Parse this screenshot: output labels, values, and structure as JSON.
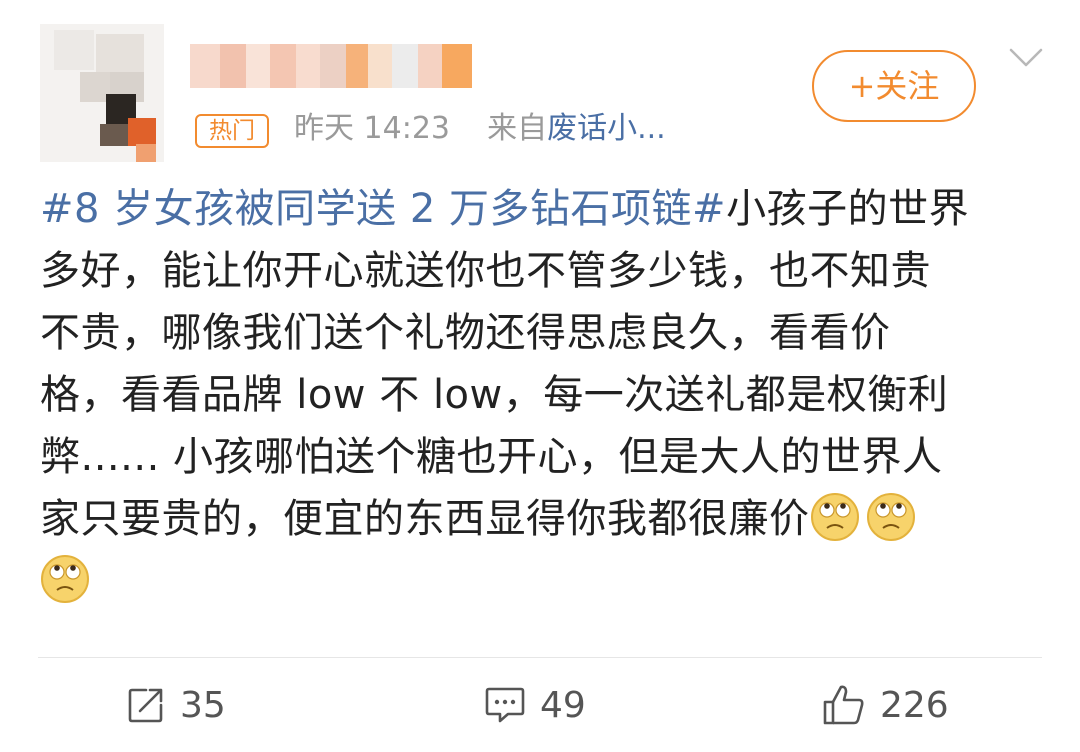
{
  "header": {
    "hot_badge": "热门",
    "time": "昨天 14:23",
    "source_prefix": "来自",
    "source_name": "废话小...",
    "follow_label": "+关注"
  },
  "post": {
    "topic": "#8 岁女孩被同学送 2 万多钻石项链#",
    "text_lines": [
      "小孩子的世界",
      "多好，能让你开心就送你也不管多少钱，也不知贵",
      "不贵，哪像我们送个礼物还得思虑良久，看看价",
      "格，看看品牌 low 不 low，每一次送礼都是权衡利",
      "弊...... 小孩哪怕送个糖也开心，但是大人的世界人",
      "家只要贵的，便宜的东西显得你我都很廉价"
    ],
    "emojis": [
      "eye-roll-emoji",
      "eye-roll-emoji",
      "eye-roll-emoji"
    ]
  },
  "actions": {
    "share_count": "35",
    "comment_count": "49",
    "like_count": "226"
  },
  "colors": {
    "accent_orange": "#f28b2f",
    "link_blue": "#4a6fa5",
    "text": "#222222",
    "meta_gray": "#9a9a9a"
  },
  "icons": {
    "share": "share-icon",
    "comment": "comment-icon",
    "like": "like-icon",
    "more": "chevron-down-icon"
  }
}
